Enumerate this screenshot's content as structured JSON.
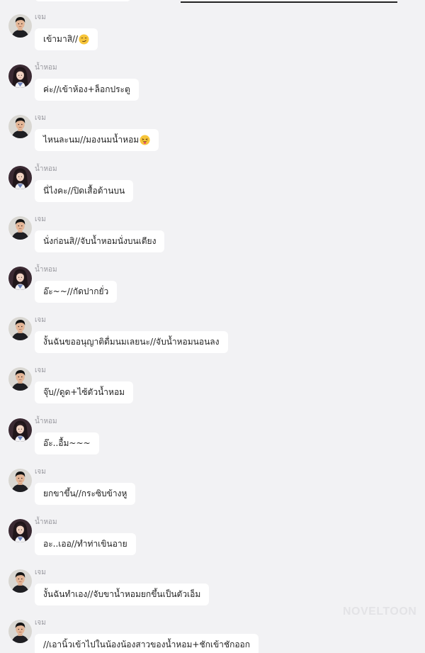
{
  "watermark": "NOVELTOON",
  "colors": {
    "background": "#f2f2f4",
    "bubble": "#ffffff",
    "sender_name": "#9a9aa0",
    "text": "#222222"
  },
  "messages": [
    {
      "sender": "เจม",
      "avatar": "male-avatar",
      "text": "เข้ามาสิ//",
      "emoji": "smirk-face-emoji"
    },
    {
      "sender": "น้ำหอม",
      "avatar": "female-avatar",
      "text": "ค่ะ//เข้าห้อง+ล็อกประตู"
    },
    {
      "sender": "เจม",
      "avatar": "male-avatar",
      "text": "ไหนละนม//มองนมน้ำหอม",
      "emoji": "tongue-face-emoji"
    },
    {
      "sender": "น้ำหอม",
      "avatar": "female-avatar",
      "text": "นี่ไงคะ//ปิดเสื้อด้านบน"
    },
    {
      "sender": "เจม",
      "avatar": "male-avatar",
      "text": "นั่งก่อนสิ//จับน้ำหอมนั่งบนเตียง"
    },
    {
      "sender": "น้ำหอม",
      "avatar": "female-avatar",
      "text": "อ๊ะ~~//กัดปากยั่ว"
    },
    {
      "sender": "เจม",
      "avatar": "male-avatar",
      "text": "งั้นฉันขออนุญาติดื่มนมเลยนะ//จับน้ำหอมนอนลง"
    },
    {
      "sender": "เจม",
      "avatar": "male-avatar",
      "text": "จุ๊บ//ดูด+ไซ้ตัวน้ำหอม"
    },
    {
      "sender": "น้ำหอม",
      "avatar": "female-avatar",
      "text": "อ๊ะ..อื้ม~~~"
    },
    {
      "sender": "เจม",
      "avatar": "male-avatar",
      "text": "ยกขาขึ้น//กระซิบข้างหู"
    },
    {
      "sender": "น้ำหอม",
      "avatar": "female-avatar",
      "text": "อะ..เออ//ทำท่าเขินอาย"
    },
    {
      "sender": "เจม",
      "avatar": "male-avatar",
      "text": "งั้นฉันทำเอง//จับขาน้ำหอมยกขึ้นเป็นตัวเอ็ม"
    },
    {
      "sender": "เจม",
      "avatar": "male-avatar",
      "text": "//เอานิ้วเข้าไปในน้องน้องสาวของน้ำหอม+ชักเข้าชักออก"
    }
  ]
}
